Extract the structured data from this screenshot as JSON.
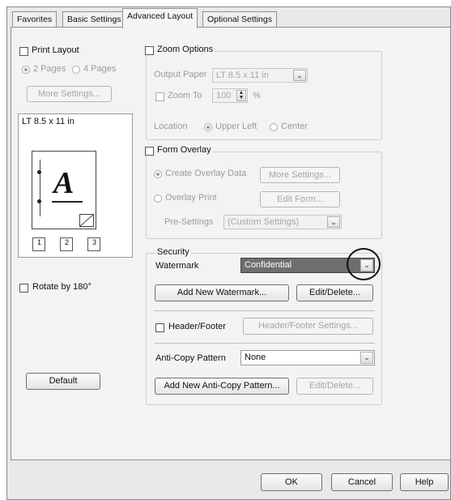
{
  "tabs": [
    "Favorites",
    "Basic Settings",
    "Advanced Layout",
    "Optional Settings"
  ],
  "print_layout": {
    "label": "Print Layout",
    "option_2": "2 Pages",
    "option_4": "4 Pages",
    "more_settings": "More Settings...",
    "paper_label": "LT 8.5 x 11 in",
    "preview_letter": "A",
    "page_numbers": [
      "1",
      "2",
      "3"
    ]
  },
  "zoom": {
    "label": "Zoom Options",
    "output_paper_label": "Output Paper",
    "output_paper_value": "LT 8.5 x 11 in",
    "zoom_to_label": "Zoom To",
    "zoom_to_value": "100",
    "percent": "%",
    "location_label": "Location",
    "upper_left": "Upper Left",
    "center": "Center"
  },
  "form_overlay": {
    "label": "Form Overlay",
    "create_overlay": "Create Overlay Data",
    "more_settings": "More Settings...",
    "overlay_print": "Overlay Print",
    "edit_form": "Edit Form...",
    "pre_settings_label": "Pre-Settings",
    "pre_settings_value": "(Custom Settings)"
  },
  "security": {
    "label": "Security",
    "watermark_label": "Watermark",
    "watermark_value": "Confidential",
    "add_watermark": "Add New Watermark...",
    "edit_delete": "Edit/Delete...",
    "header_footer_label": "Header/Footer",
    "header_footer_settings": "Header/Footer Settings...",
    "anti_copy_label": "Anti-Copy Pattern",
    "anti_copy_value": "None",
    "add_anti_copy": "Add New Anti-Copy Pattern...",
    "edit_delete_2": "Edit/Delete..."
  },
  "rotate": "Rotate by 180°",
  "default_button": "Default",
  "footer": {
    "ok": "OK",
    "cancel": "Cancel",
    "help": "Help"
  }
}
